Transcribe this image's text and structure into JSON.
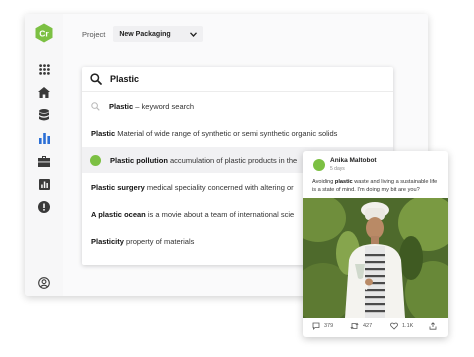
{
  "app": {
    "logo_text": "Cr",
    "brand_color": "#7cc043",
    "project_label": "Project",
    "project_value": "New Packaging",
    "nav_icons": [
      "apps-grid-icon",
      "home-icon",
      "database-icon",
      "bar-chart-icon",
      "briefcase-icon",
      "report-icon",
      "alert-icon",
      "user-icon"
    ],
    "active_nav": "bar-chart-icon"
  },
  "search": {
    "query": "Plastic",
    "suggestions": [
      {
        "type": "keyword",
        "term": "Plastic",
        "desc": "– keyword search"
      },
      {
        "type": "definition",
        "term": "Plastic",
        "desc": "Material of wide range of synthetic or semi synthetic organic solids"
      },
      {
        "type": "entity",
        "term": "Plastic pollution",
        "desc": "accumulation of plastic products in the",
        "highlighted": true
      },
      {
        "type": "definition",
        "term": "Plastic surgery",
        "desc": "medical speciality concerned with altering or"
      },
      {
        "type": "definition",
        "term": "A plastic ocean",
        "desc": "is a movie about a team of international scie"
      },
      {
        "type": "definition",
        "term": "Plasticity",
        "desc": "property of materials"
      }
    ]
  },
  "post": {
    "author": "Anika Maltobot",
    "age": "5 days",
    "text_before": "Avoiding ",
    "text_bold": "plastic",
    "text_after": " waste and living a sustainable life is a state of mind. I'm doing my bit are you?",
    "comments": "379",
    "retweets": "427",
    "likes": "1.1K"
  }
}
